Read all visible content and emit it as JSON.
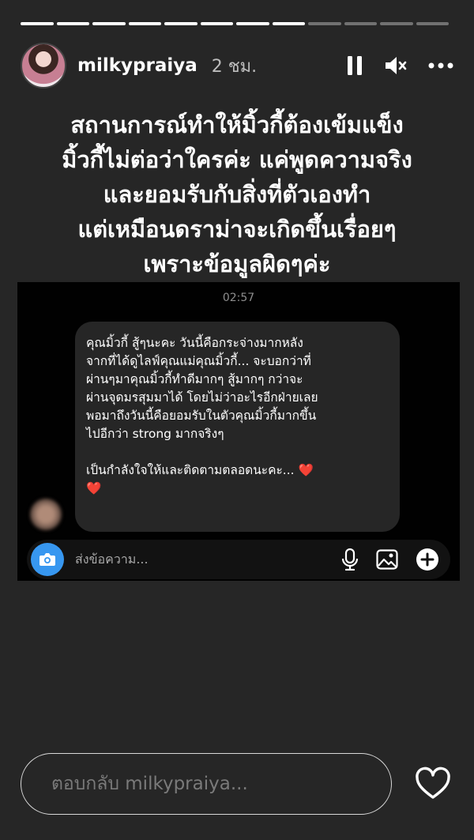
{
  "story": {
    "segments_total": 12,
    "segments_viewed": 8
  },
  "header": {
    "username": "milkypraiya",
    "time": "2 ชม.",
    "icons": [
      "pause-icon",
      "mute-icon",
      "more-icon"
    ]
  },
  "caption": {
    "lines": [
      "สถานการณ์ทำให้มิ้วกี้ต้องเข้มแข็ง",
      "มิ้วกี้ไม่ต่อว่าใครค่ะ แค่พูดความจริง",
      "และยอมรับกับสิ่งที่ตัวเองทำ",
      "แต่เหมือนดราม่าจะเกิดขึ้นเรื่อยๆ",
      "เพราะข้อมูลผิดๆค่ะ"
    ]
  },
  "screenshot": {
    "time": "02:57",
    "message": {
      "lines": [
        "คุณมิ้วกี้ สู้ๆนะคะ วันนี้คือกระจ่างมากหลัง",
        "จากที่ได้ดูไลฟ์คุณแม่คุณมิ้วกี้... จะบอกว่าที่",
        "ผ่านๆมาคุณมิ้วกี้ทำดีมากๆ สู้มากๆ กว่าจะ",
        "ผ่านจุดมรสุมมาได้ โดยไม่ว่าอะไรอีกฝ่ายเลย",
        "พอมาถึงวันนี้คือยอมรับในตัวคุณมิ้วกี้มากขึ้น",
        "ไปอีกว่า strong มากจริงๆ"
      ],
      "closing": "เป็นกำลังใจให้และติดตามตลอดนะคะ...",
      "heart1": "❤️",
      "heart2": "❤️"
    },
    "composer": {
      "placeholder": "ส่งข้อความ..."
    }
  },
  "reply": {
    "placeholder": "ตอบกลับ milkypraiya..."
  },
  "colors": {
    "background": "#262626",
    "camera_button": "#3797f0",
    "heart": "#e0162b"
  }
}
